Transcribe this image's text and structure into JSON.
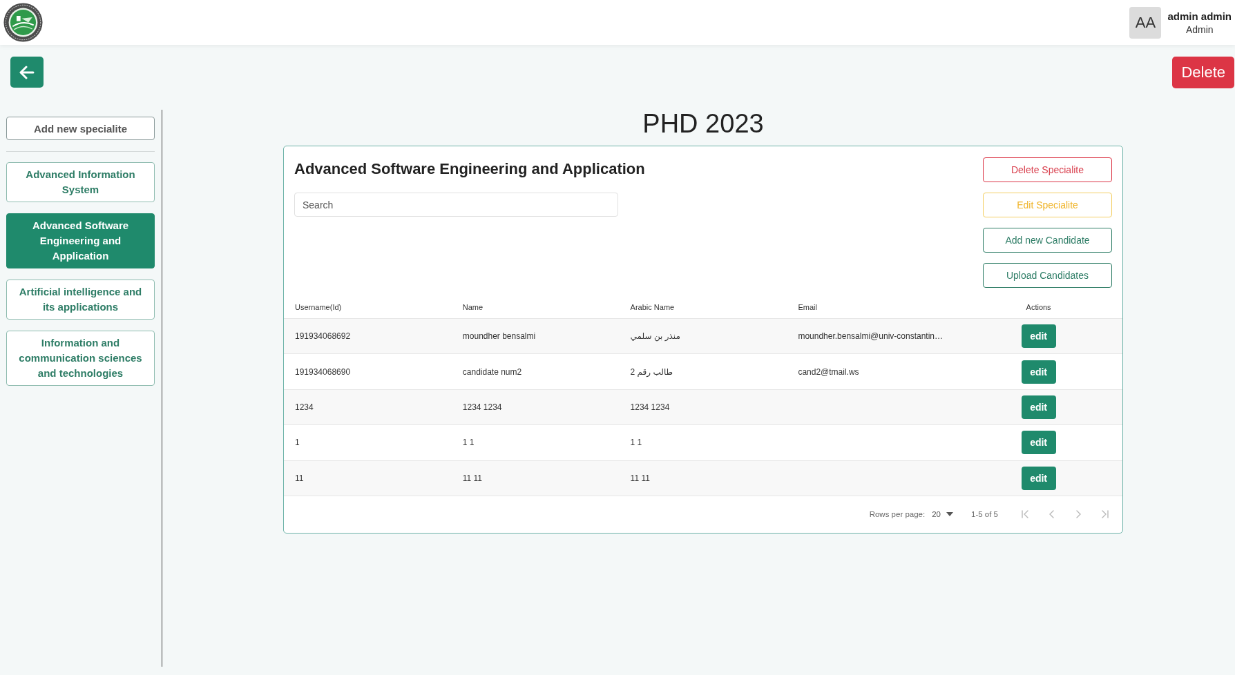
{
  "header": {
    "avatar_initials": "AA",
    "user_name": "admin admin",
    "user_role": "Admin"
  },
  "toolbar": {
    "delete_label": "Delete"
  },
  "sidebar": {
    "add_label": "Add new specialite",
    "items": [
      {
        "label": "Advanced Information System",
        "selected": false
      },
      {
        "label": "Advanced Software Engineering and Application",
        "selected": true
      },
      {
        "label": "Artificial intelligence and its applications",
        "selected": false
      },
      {
        "label": "Information and communication sciences and technologies",
        "selected": false
      }
    ]
  },
  "page_title": "PHD 2023",
  "card": {
    "title": "Advanced Software Engineering and Application",
    "search": {
      "placeholder": "Search"
    },
    "actions": [
      {
        "kind": "delete",
        "label": "Delete Specialite"
      },
      {
        "kind": "edit",
        "label": "Edit Specialite"
      },
      {
        "kind": "add",
        "label": "Add new Candidate"
      },
      {
        "kind": "upload",
        "label": "Upload Candidates"
      }
    ]
  },
  "table": {
    "columns": [
      "Username(Id)",
      "Name",
      "Arabic Name",
      "Email",
      "Actions"
    ],
    "rows": [
      {
        "username": "191934068692",
        "name": "moundher bensalmi",
        "arabic_name": "منذر بن سلمي",
        "email": "moundher.bensalmi@univ-constantin…",
        "action": "edit"
      },
      {
        "username": "191934068690",
        "name": "candidate num2",
        "arabic_name": "طالب رقم 2",
        "email": "cand2@tmail.ws",
        "action": "edit"
      },
      {
        "username": "1234",
        "name": "1234 1234",
        "arabic_name": "1234 1234",
        "action": "edit"
      },
      {
        "username": "1",
        "name": "1 1",
        "arabic_name": "1 1",
        "action": "edit"
      },
      {
        "username": "11",
        "name": "11 11",
        "arabic_name": "11 11",
        "action": "edit"
      }
    ]
  },
  "pagination": {
    "rows_per_page_label": "Rows per page:",
    "rows_per_page": "20",
    "range": "1-5 of 5",
    "nav": [
      {
        "kind": "first",
        "disabled": true
      },
      {
        "kind": "previous",
        "disabled": true
      },
      {
        "kind": "next",
        "disabled": true
      },
      {
        "kind": "last",
        "disabled": true
      }
    ]
  }
}
